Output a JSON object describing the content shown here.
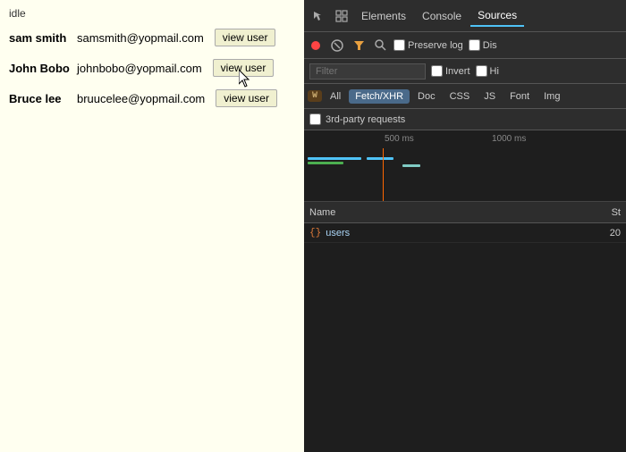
{
  "left": {
    "status": "idle",
    "users": [
      {
        "name": "sam smith",
        "email": "samsmith@yopmail.com",
        "btn": "view user"
      },
      {
        "name": "John Bobo",
        "email": "johnbobo@yopmail.com",
        "btn": "view user"
      },
      {
        "name": "Bruce lee",
        "email": "bruucelee@yopmail.com",
        "btn": "view user"
      }
    ]
  },
  "devtools": {
    "tabs": [
      "Elements",
      "Console",
      "Sources"
    ],
    "network_toolbar": {
      "preserve_log": "Preserve log",
      "dis": "Dis"
    },
    "filter_placeholder": "Filter",
    "invert_label": "Invert",
    "hi_label": "Hi",
    "type_buttons": [
      "All",
      "Fetch/XHR",
      "Doc",
      "CSS",
      "JS",
      "Font",
      "Img"
    ],
    "active_type": "Fetch/XHR",
    "third_party": "3rd-party requests",
    "timeline": {
      "marks": [
        "500 ms",
        "1000 ms"
      ]
    },
    "table": {
      "name_col": "Name",
      "status_col": "St",
      "rows": [
        {
          "name": "users",
          "status": "20"
        }
      ]
    }
  }
}
